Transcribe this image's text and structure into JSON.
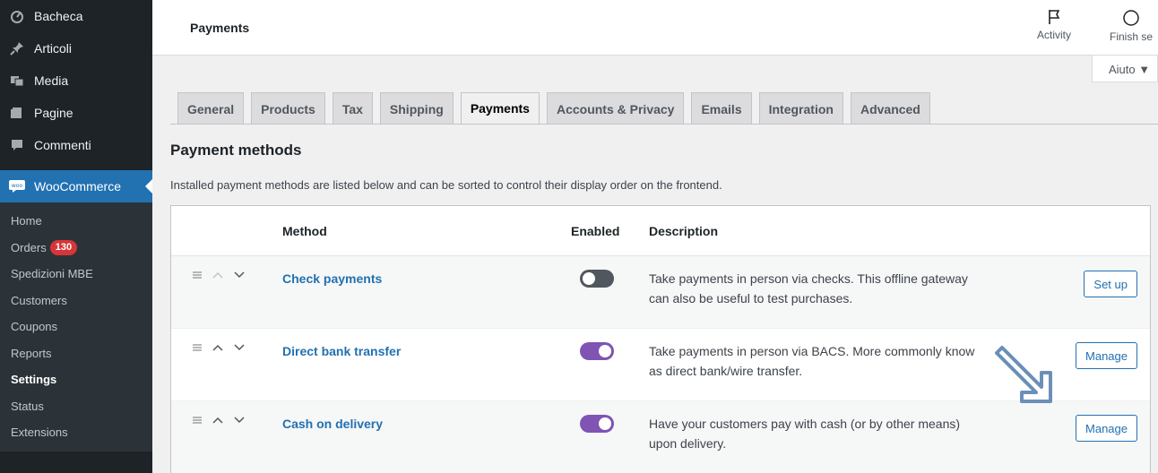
{
  "sidebar": {
    "top_items": [
      {
        "label": "Bacheca",
        "icon": "dashboard-icon"
      },
      {
        "label": "Articoli",
        "icon": "pin-icon"
      },
      {
        "label": "Media",
        "icon": "media-icon"
      },
      {
        "label": "Pagine",
        "icon": "pages-icon"
      },
      {
        "label": "Commenti",
        "icon": "comment-icon"
      }
    ],
    "woocommerce": {
      "label": "WooCommerce",
      "icon_text": "woo"
    },
    "submenu": [
      {
        "label": "Home"
      },
      {
        "label": "Orders",
        "badge": "130"
      },
      {
        "label": "Spedizioni MBE"
      },
      {
        "label": "Customers"
      },
      {
        "label": "Coupons"
      },
      {
        "label": "Reports"
      },
      {
        "label": "Settings",
        "current": true
      },
      {
        "label": "Status"
      },
      {
        "label": "Extensions"
      }
    ]
  },
  "header": {
    "title": "Payments",
    "activity_label": "Activity",
    "finish_label": "Finish se",
    "help_label": "Aiuto ▼"
  },
  "tabs": [
    "General",
    "Products",
    "Tax",
    "Shipping",
    "Payments",
    "Accounts & Privacy",
    "Emails",
    "Integration",
    "Advanced"
  ],
  "active_tab": "Payments",
  "section": {
    "heading": "Payment methods",
    "description": "Installed payment methods are listed below and can be sorted to control their display order on the frontend."
  },
  "table": {
    "columns": {
      "method": "Method",
      "enabled": "Enabled",
      "description": "Description"
    },
    "rows": [
      {
        "name": "Check payments",
        "enabled": false,
        "desc_line1": "Take payments in person via checks. This offline gateway",
        "desc_line2": "can also be useful to test purchases.",
        "button": "Set up"
      },
      {
        "name": "Direct bank transfer",
        "enabled": true,
        "desc_line1": "Take payments in person via BACS. More commonly know",
        "desc_line2": "as direct bank/wire transfer.",
        "button": "Manage"
      },
      {
        "name": "Cash on delivery",
        "enabled": true,
        "desc_line1": "Have your customers pay with cash (or by other means)",
        "desc_line2": "upon delivery.",
        "button": "Manage"
      }
    ]
  },
  "colors": {
    "sidebar_bg": "#1d2327",
    "accent": "#2271b1",
    "toggle_on": "#7f54b3",
    "toggle_off": "#50575e",
    "badge": "#d63638",
    "annotation_arrow": "#6b8fb8"
  }
}
